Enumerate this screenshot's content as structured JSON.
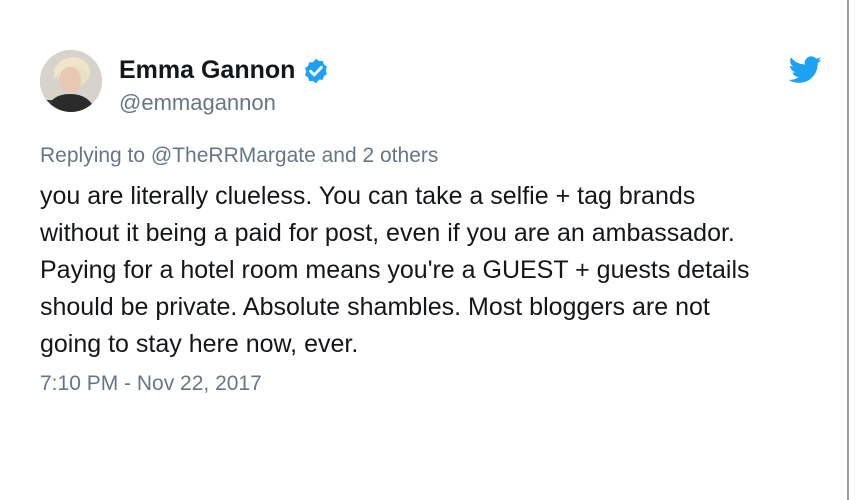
{
  "author": {
    "display_name": "Emma Gannon",
    "handle": "@emmagannon",
    "verified": true,
    "avatar_icon": "profile-photo"
  },
  "reply": {
    "prefix": "Replying to ",
    "mention": "@TheRRMargate",
    "suffix": " and 2 others"
  },
  "tweet": {
    "lines": [
      "you are literally clueless. You can take a selfie + tag brands",
      "without it being a paid for post, even if you are an ambassador.",
      "Paying for a hotel room means you're a GUEST + guests details",
      "should be private. Absolute shambles. Most bloggers are not",
      "going to stay here now, ever."
    ],
    "timestamp": "7:10 PM - Nov 22, 2017"
  },
  "icons": {
    "verified": "verified-badge-icon",
    "brand": "twitter-bird-icon"
  },
  "colors": {
    "text": "#14171a",
    "secondary": "#657786",
    "brand_blue": "#1da1f2"
  }
}
